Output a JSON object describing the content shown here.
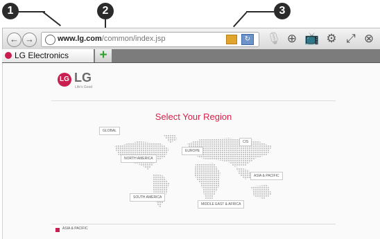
{
  "callouts": {
    "one": "1",
    "two": "2",
    "three": "3"
  },
  "toolbar": {
    "url_host": "www.lg.com",
    "url_path": "/common/index.jsp",
    "back_icon": "back-arrow-icon",
    "forward_icon": "forward-arrow-icon",
    "icons": [
      "zoom-in-icon",
      "tv-icon",
      "settings-icon",
      "fullscreen-icon",
      "close-icon"
    ]
  },
  "tabs": {
    "active_title": "LG Electronics",
    "new_tab_label": "+"
  },
  "page": {
    "logo_text": "LG",
    "logo_mark": "LG",
    "logo_tagline": "Life's Good",
    "heading": "Select Your Region",
    "regions": [
      "GLOBAL",
      "EUROPE",
      "CIS",
      "NORTH AMERICA",
      "ASIA & PACIFIC",
      "SOUTH AMERICA",
      "MIDDLE EAST & AFRICA"
    ],
    "footer_item": "ASIA & PACIFIC"
  },
  "colors": {
    "brand": "#c81e50",
    "heading": "#d61e47",
    "new_tab_plus": "#2ea02e"
  }
}
